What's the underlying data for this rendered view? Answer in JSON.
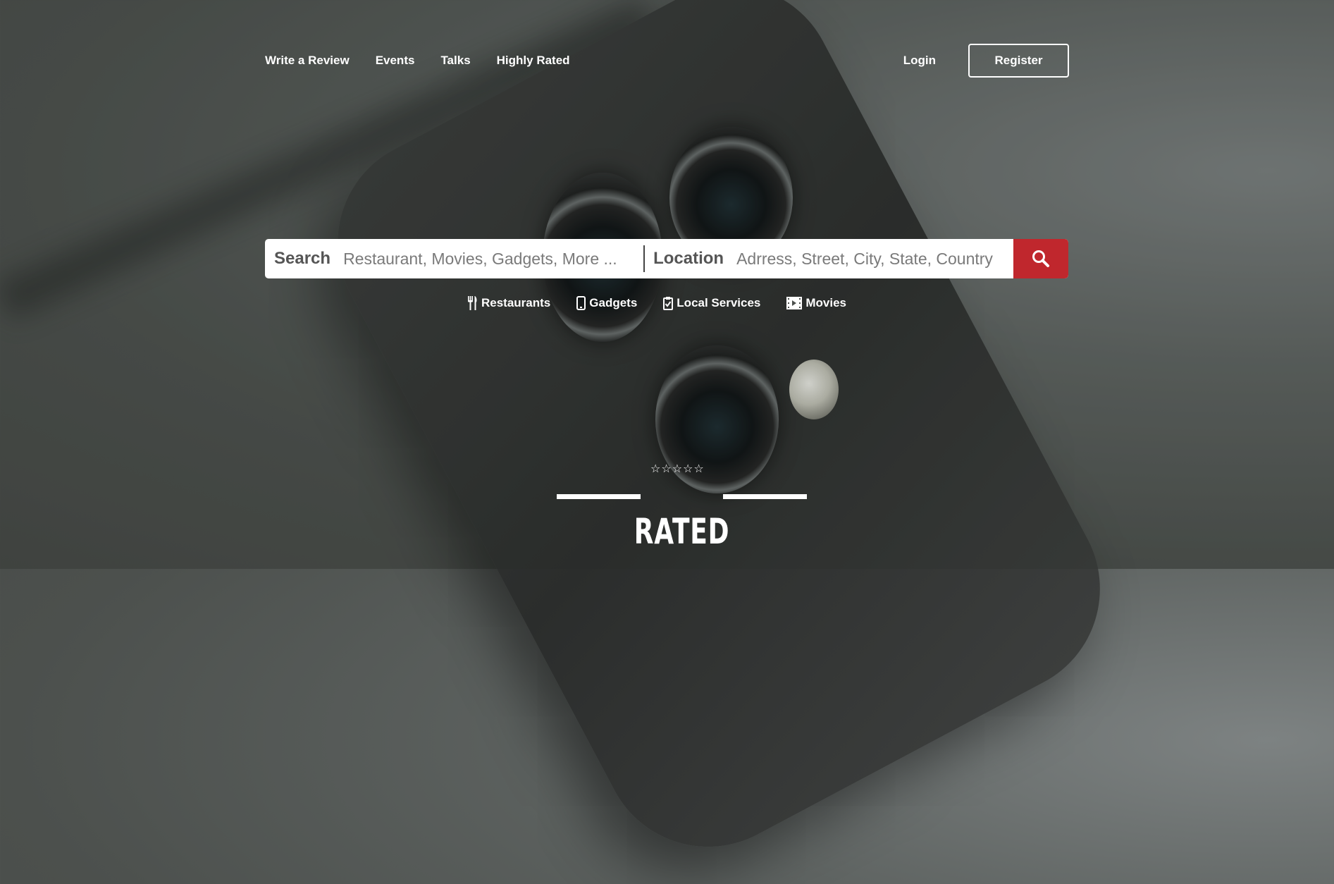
{
  "nav": {
    "links": [
      "Write a Review",
      "Events",
      "Talks",
      "Highly Rated"
    ],
    "login": "Login",
    "register": "Register"
  },
  "search": {
    "label": "Search",
    "placeholder": "Restaurant, Movies, Gadgets, More ...",
    "location_label": "Location",
    "location_placeholder": "Adrress, Street, City, State, Country",
    "button_icon": "search-icon"
  },
  "categories": [
    {
      "label": "Restaurants",
      "icon": "fork-knife-icon"
    },
    {
      "label": "Gadgets",
      "icon": "mobile-icon"
    },
    {
      "label": "Local Services",
      "icon": "clipboard-check-icon"
    },
    {
      "label": "Movies",
      "icon": "film-icon"
    }
  ],
  "logo": {
    "stars": "☆☆☆☆☆",
    "word": "RATED"
  },
  "colors": {
    "accent": "#c0272d",
    "text": "#ffffff"
  }
}
